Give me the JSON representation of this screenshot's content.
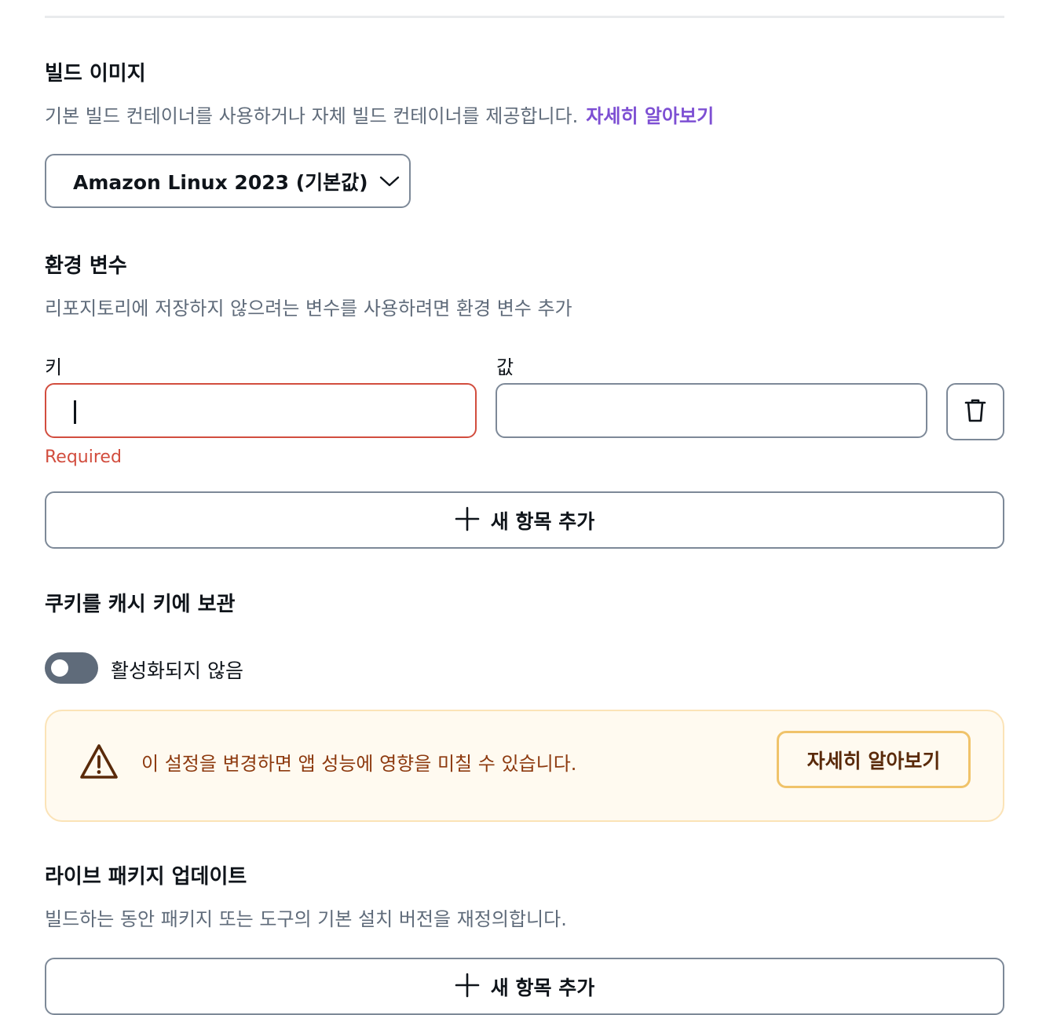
{
  "build_image": {
    "title": "빌드 이미지",
    "description": "기본 빌드 컨테이너를 사용하거나 자체 빌드 컨테이너를 제공합니다.",
    "learn_more": "자세히 알아보기",
    "selected": "Amazon Linux 2023 (기본값)"
  },
  "env_vars": {
    "title": "환경 변수",
    "description": "리포지토리에 저장하지 않으려는 변수를 사용하려면 환경 변수 추가",
    "key_label": "키",
    "value_label": "값",
    "key_value": "",
    "value_value": "",
    "error_text": "Required",
    "add_label": "새 항목 추가"
  },
  "cookies": {
    "title": "쿠키를 캐시 키에 보관",
    "toggle_label": "활성화되지 않음",
    "toggle_on": false
  },
  "alert": {
    "text": "이 설정을 변경하면 앱 성능에 영향을 미칠 수 있습니다.",
    "button": "자세히 알아보기"
  },
  "live_packages": {
    "title": "라이브 패키지 업데이트",
    "description": "빌드하는 동안 패키지 또는 도구의 기본 설치 버전을 재정의합니다.",
    "add_label": "새 항목 추가"
  },
  "icons": {
    "dropdown": "chevron-down-icon",
    "delete": "trash-icon",
    "add": "plus-icon",
    "warning": "warning-icon"
  },
  "colors": {
    "link": "#7d4fd3",
    "error": "#d24d3e",
    "alert_bg": "#fffaf0",
    "alert_border": "#f0c36a",
    "alert_text": "#8d3a0f"
  }
}
